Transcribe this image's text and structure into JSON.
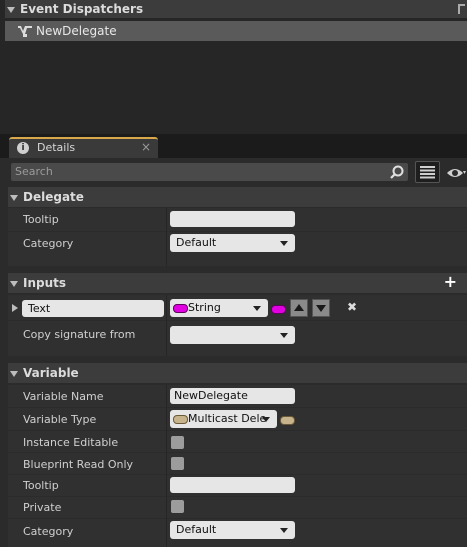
{
  "event_dispatchers": {
    "title": "Event Dispatchers",
    "item": "NewDelegate"
  },
  "details_tab": {
    "label": "Details",
    "close_glyph": "×"
  },
  "search": {
    "placeholder": "Search"
  },
  "delegate": {
    "header": "Delegate",
    "tooltip_label": "Tooltip",
    "tooltip_value": "",
    "category_label": "Category",
    "category_value": "Default"
  },
  "inputs": {
    "header": "Inputs",
    "add_glyph": "+",
    "param_name": "Text",
    "param_type": "String",
    "remove_glyph": "✖",
    "copy_label": "Copy signature from",
    "copy_value": ""
  },
  "variable": {
    "header": "Variable",
    "name_label": "Variable Name",
    "name_value": "NewDelegate",
    "type_label": "Variable Type",
    "type_value": "Multicast Deleg",
    "instance_editable_label": "Instance Editable",
    "blueprint_readonly_label": "Blueprint Read Only",
    "tooltip_label": "Tooltip",
    "tooltip_value": "",
    "private_label": "Private",
    "category_label": "Category",
    "category_value": "Default"
  },
  "colors": {
    "string_pin": "#e000e0",
    "delegate_pin": "#c8b48c",
    "header_bg": "#3c3c3c",
    "row_bg": "#303030"
  }
}
